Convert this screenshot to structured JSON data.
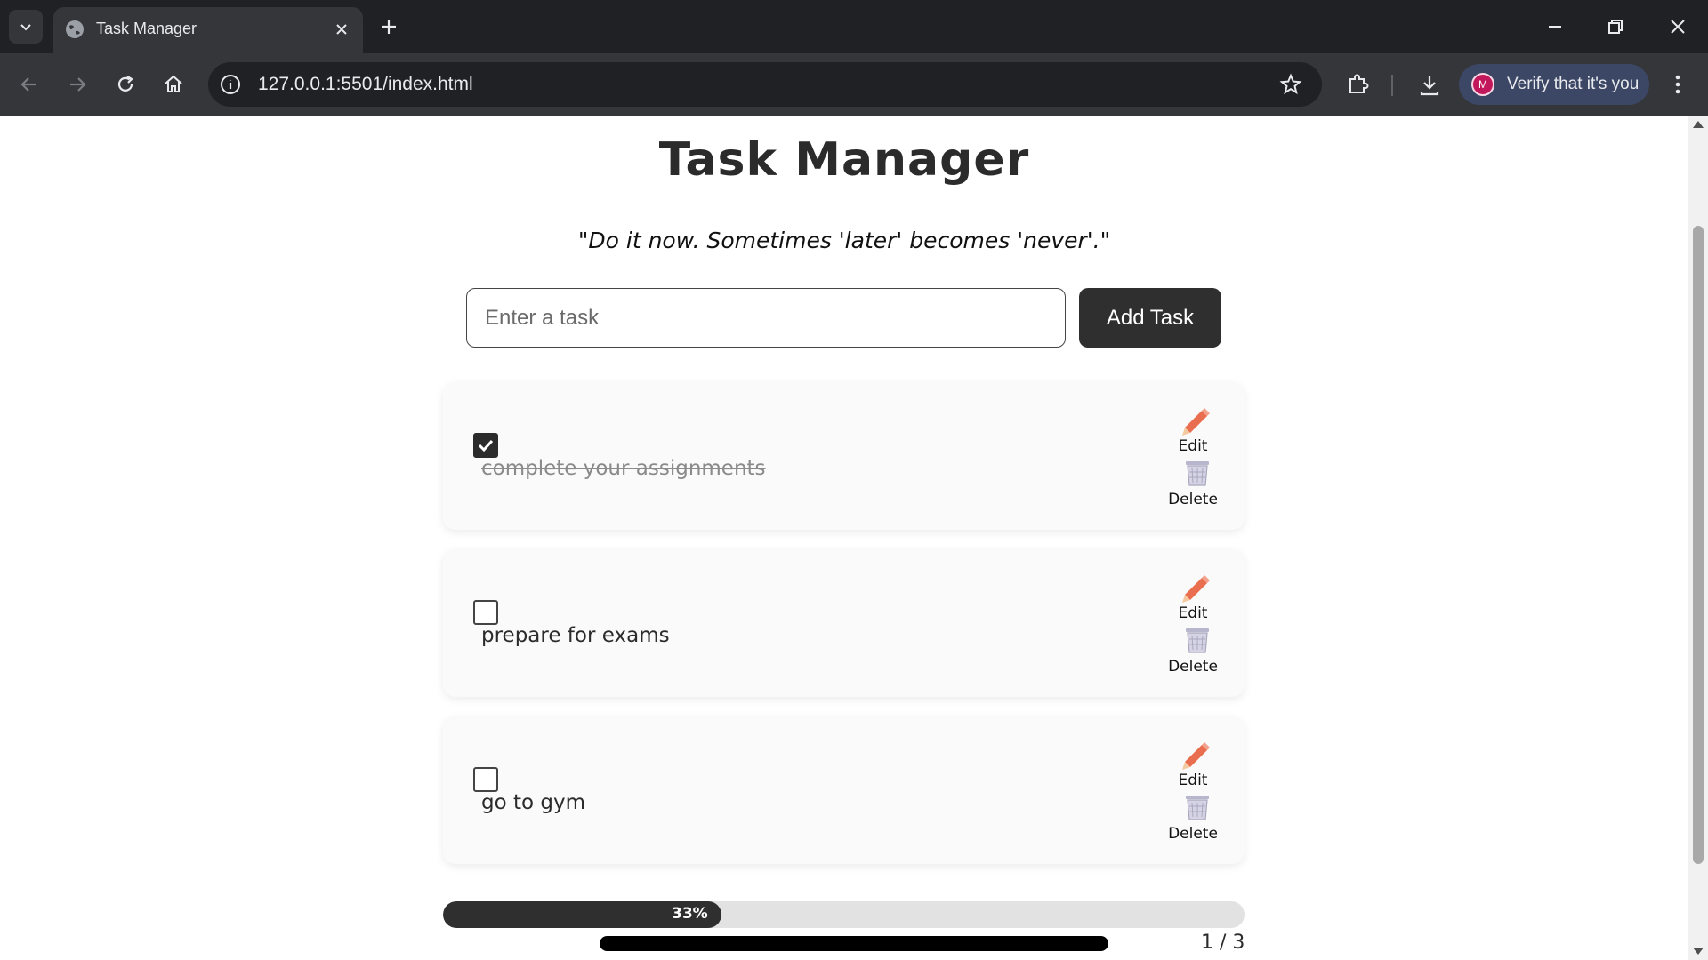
{
  "browser": {
    "tab_title": "Task Manager",
    "url": "127.0.0.1:5501/index.html",
    "profile_label": "Verify that it's you",
    "profile_initial": "M"
  },
  "page": {
    "title": "Task Manager",
    "quote": "\"Do it now. Sometimes 'later' becomes 'never'.\"",
    "input_placeholder": "Enter a task",
    "input_value": "",
    "add_button_label": "Add Task"
  },
  "tasks": [
    {
      "text": "complete your assignments",
      "completed": true,
      "edit_label": "Edit",
      "delete_label": "Delete"
    },
    {
      "text": "prepare for exams",
      "completed": false,
      "edit_label": "Edit",
      "delete_label": "Delete"
    },
    {
      "text": "go to gym",
      "completed": false,
      "edit_label": "Edit",
      "delete_label": "Delete"
    }
  ],
  "progress": {
    "percent": 33,
    "percent_label": "33%",
    "count_label": "1 / 3"
  },
  "colors": {
    "chrome_dark": "#202124",
    "chrome_toolbar": "#35363a",
    "accent_dark": "#2f2f2f",
    "edit_icon": "#e96d4f",
    "delete_icon": "#b8b6cc"
  },
  "icons": {
    "edit": "pencil-icon",
    "delete": "trash-icon",
    "checkbox": "checkmark-icon"
  }
}
